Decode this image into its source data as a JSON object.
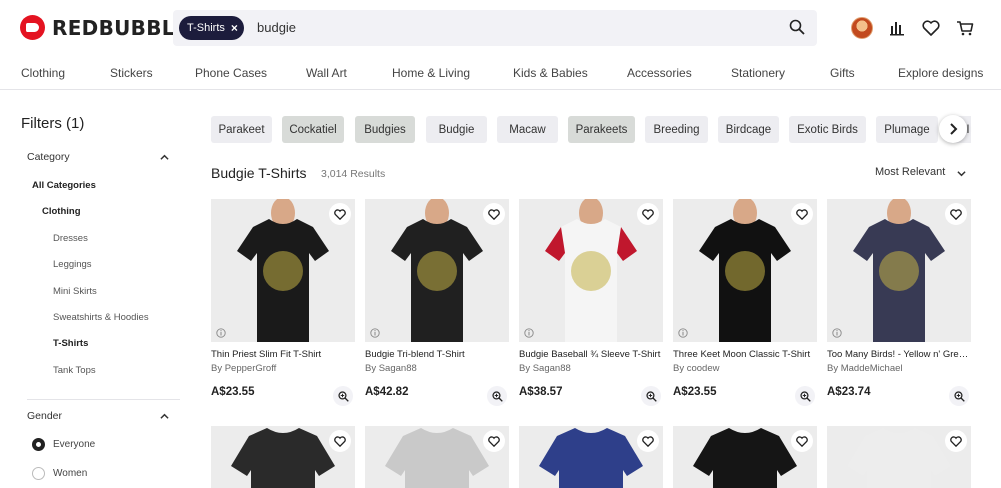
{
  "header": {
    "logo_text": "REDBUBBLE",
    "search_chip": "T-Shirts",
    "search_chip_close": "×",
    "search_value": "budgie",
    "icons": [
      "avatar",
      "bar-chart-icon",
      "heart-icon",
      "cart-icon"
    ]
  },
  "nav": {
    "items": [
      "Clothing",
      "Stickers",
      "Phone Cases",
      "Wall Art",
      "Home & Living",
      "Kids & Babies",
      "Accessories",
      "Stationery",
      "Gifts",
      "Explore designs"
    ]
  },
  "sidebar": {
    "title": "Filters (1)",
    "category_heading": "Category",
    "categories": [
      "All Categories",
      "Clothing",
      "Dresses",
      "Leggings",
      "Mini Skirts",
      "Sweatshirts & Hoodies",
      "T-Shirts",
      "Tank Tops"
    ],
    "gender_heading": "Gender",
    "genders": [
      "Everyone",
      "Women"
    ]
  },
  "tags": [
    "Parakeet",
    "Cockatiel",
    "Budgies",
    "Budgie",
    "Macaw",
    "Parakeets",
    "Breeding",
    "Birdcage",
    "Exotic Birds",
    "Plumage",
    "I"
  ],
  "results": {
    "title": "Budgie T-Shirts",
    "count": "3,014 Results",
    "sort": "Most Relevant"
  },
  "products": [
    {
      "title": "Thin Priest Slim Fit T-Shirt",
      "artist": "By PepperGroff",
      "price": "A$23.55",
      "shirt_color": "#1a1a1a"
    },
    {
      "title": "Budgie Tri-blend T-Shirt",
      "artist": "By Sagan88",
      "price": "A$42.82",
      "shirt_color": "#202020"
    },
    {
      "title": "Budgie Baseball ¾ Sleeve T-Shirt",
      "artist": "By Sagan88",
      "price": "A$38.57",
      "shirt_color": "#f5f5f5"
    },
    {
      "title": "Three Keet Moon Classic T-Shirt",
      "artist": "By coodew",
      "price": "A$23.55",
      "shirt_color": "#111111"
    },
    {
      "title": "Too Many Birds! - Yellow n' Green Classic T-Shirt",
      "artist": "By MaddeMichael",
      "price": "A$23.74",
      "shirt_color": "#383a54"
    }
  ],
  "products_row2_colors": [
    "#2a2a2a",
    "#c9c9c9",
    "#2e3f8a",
    "#151515",
    "#ededed"
  ],
  "colors": {
    "brand_red": "#e41321",
    "chip_navy": "#1c1c3c",
    "baseball_sleeve": "#c0172d"
  }
}
